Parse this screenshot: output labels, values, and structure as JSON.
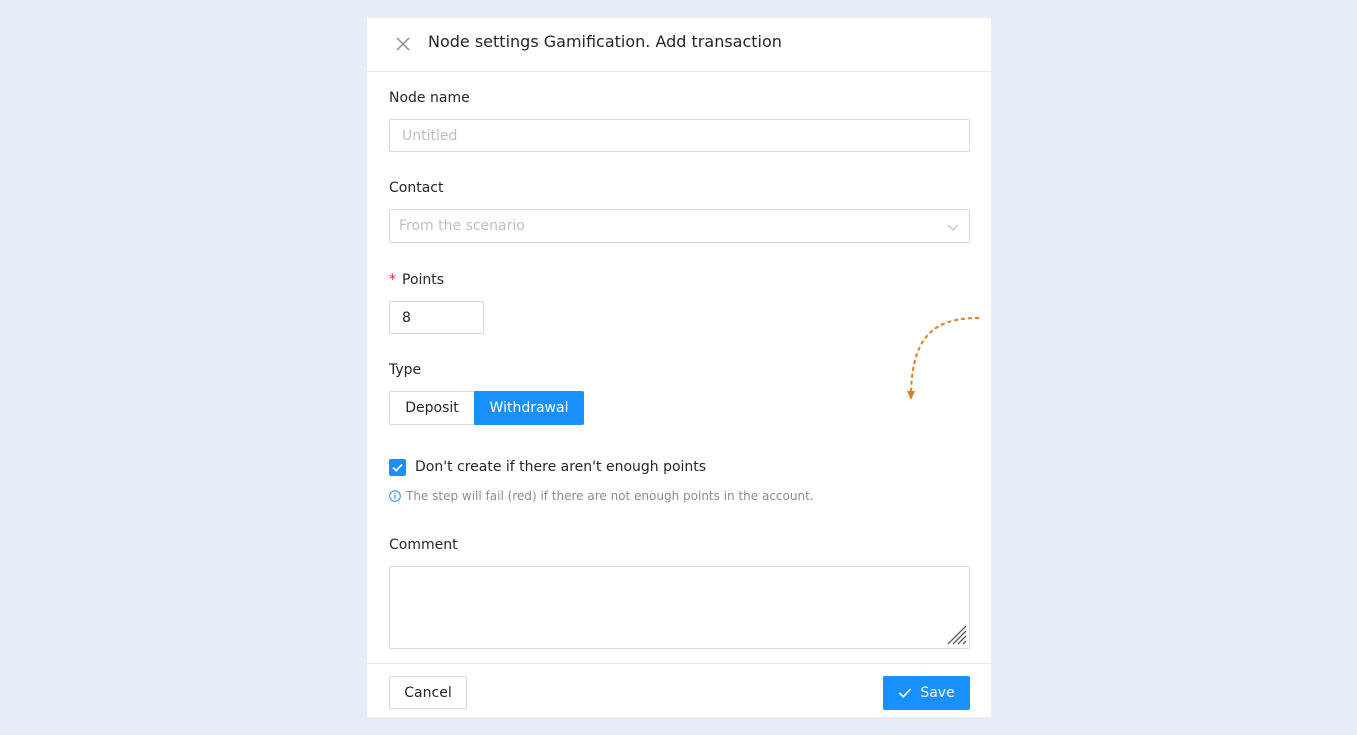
{
  "modal": {
    "title": "Node settings Gamification. Add transaction"
  },
  "form": {
    "node_name": {
      "label": "Node name",
      "placeholder": "Untitled",
      "value": ""
    },
    "contact": {
      "label": "Contact",
      "placeholder": "From the scenario"
    },
    "points": {
      "label": "Points",
      "required_mark": "*",
      "value": "8"
    },
    "type": {
      "label": "Type",
      "options": [
        "Deposit",
        "Withdrawal"
      ],
      "selected": "Withdrawal"
    },
    "not_enough_checkbox": {
      "label": "Don't create if there aren't enough points",
      "checked": true
    },
    "hint": "The step will fail (red) if there are not enough points in the account.",
    "comment": {
      "label": "Comment",
      "value": ""
    }
  },
  "footer": {
    "cancel_label": "Cancel",
    "save_label": "Save"
  },
  "colors": {
    "accent": "#1890ff",
    "required": "#f5222d",
    "annotation": "#e67e22",
    "background": "#e6edf6"
  }
}
